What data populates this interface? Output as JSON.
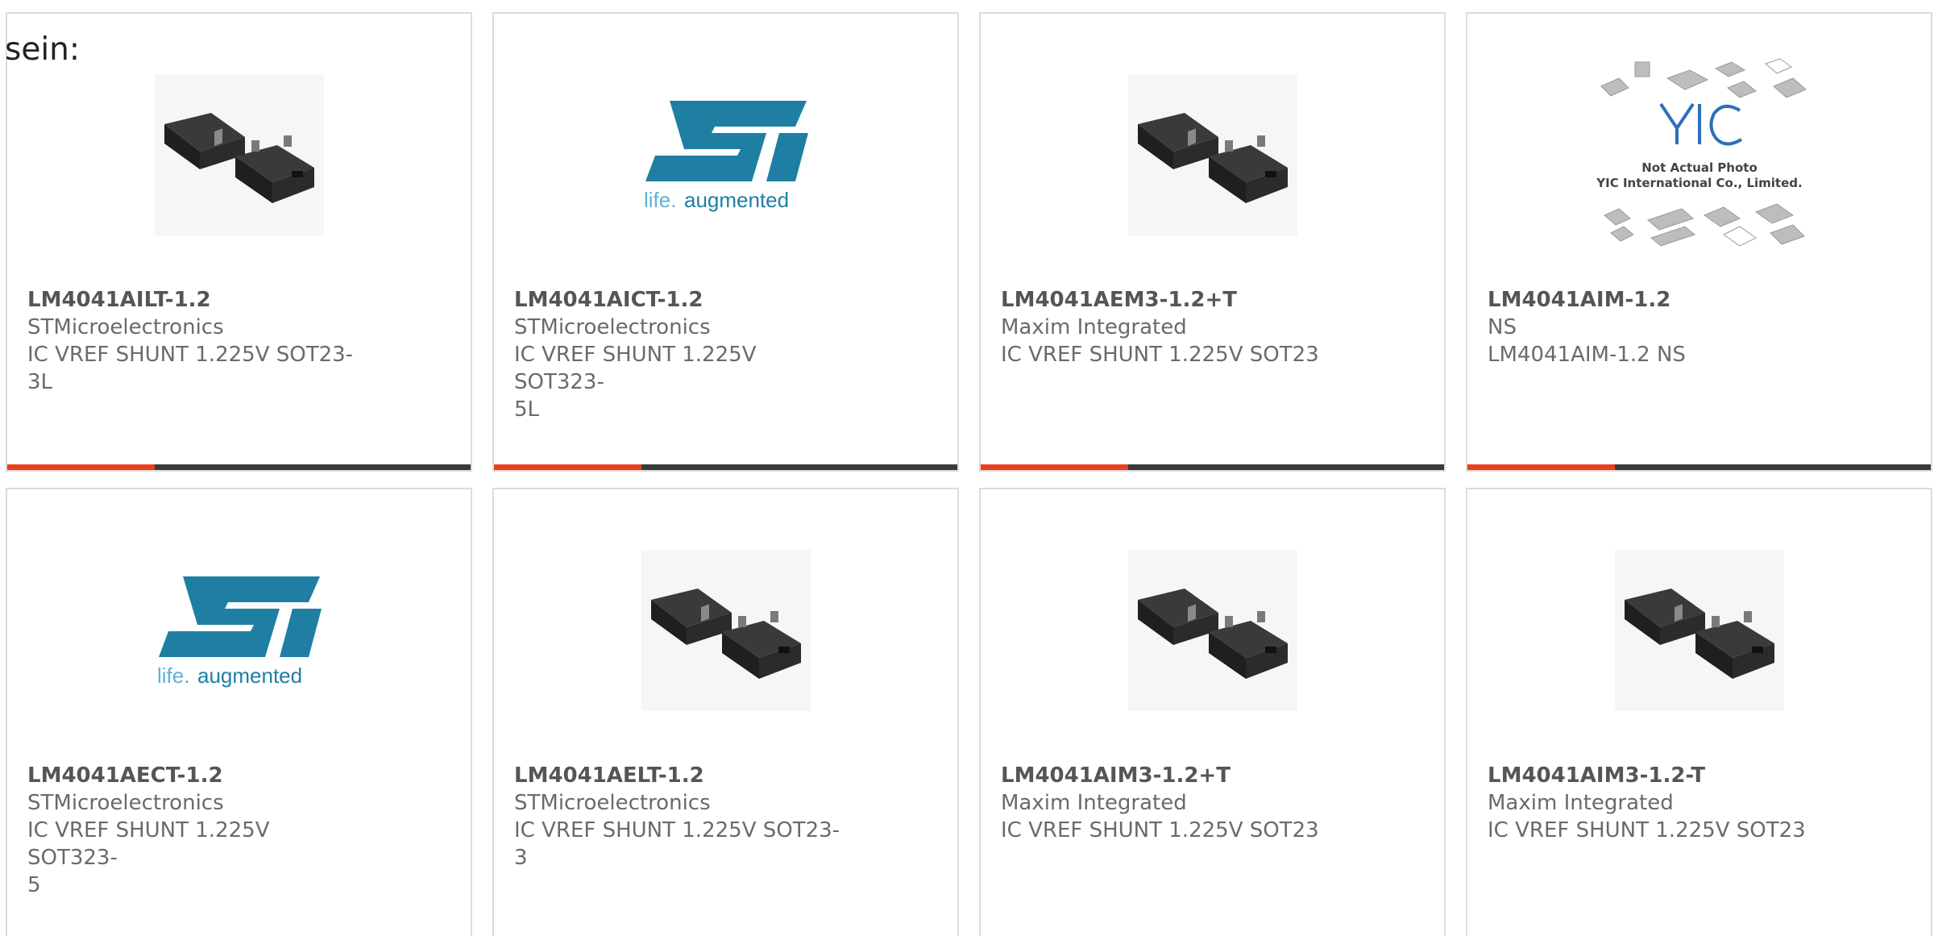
{
  "intro_text": "sein:",
  "colors": {
    "accent": "#e8401c",
    "bar_dark": "#3a3a3a",
    "card_border": "#dcdcdc",
    "st_blue": "#1f7fa3",
    "st_light": "#5bb3d6",
    "yic_blue": "#2d6fb8"
  },
  "products": [
    {
      "part": "LM4041AILT-1.2",
      "manufacturer": "STMicroelectronics",
      "description": "IC VREF SHUNT 1.225V SOT23-\n3L",
      "image": "sot23-chip",
      "desc_lines": [
        "IC VREF SHUNT 1.225V SOT23-",
        "3L"
      ]
    },
    {
      "part": "LM4041AICT-1.2",
      "manufacturer": "STMicroelectronics",
      "description": "IC VREF SHUNT 1.225V SOT323-\n5L",
      "image": "st-logo",
      "logo_tagline": "life.augmented",
      "desc_lines": [
        "IC VREF SHUNT 1.225V SOT323-",
        "5L"
      ]
    },
    {
      "part": "LM4041AEM3-1.2+T",
      "manufacturer": "Maxim Integrated",
      "description": "IC VREF SHUNT 1.225V SOT23",
      "image": "sot23-chip",
      "desc_lines": [
        "IC VREF SHUNT 1.225V SOT23"
      ]
    },
    {
      "part": "LM4041AIM-1.2",
      "manufacturer": "NS",
      "description": "LM4041AIM-1.2 NS",
      "image": "yic-placeholder",
      "placeholder_line1": "Not Actual Photo",
      "placeholder_line2": "YIC International Co., Limited.",
      "desc_lines": [
        "LM4041AIM-1.2 NS"
      ]
    },
    {
      "part": "LM4041AECT-1.2",
      "manufacturer": "STMicroelectronics",
      "description": "IC VREF SHUNT 1.225V SOT323-\n5",
      "image": "st-logo",
      "logo_tagline": "life.augmented",
      "desc_lines": [
        "IC VREF SHUNT 1.225V SOT323-",
        "5"
      ]
    },
    {
      "part": "LM4041AELT-1.2",
      "manufacturer": "STMicroelectronics",
      "description": "IC VREF SHUNT 1.225V SOT23-3",
      "image": "sot23-chip",
      "desc_lines": [
        "IC VREF SHUNT 1.225V SOT23-3"
      ]
    },
    {
      "part": "LM4041AIM3-1.2+T",
      "manufacturer": "Maxim Integrated",
      "description": "IC VREF SHUNT 1.225V SOT23",
      "image": "sot23-chip",
      "desc_lines": [
        "IC VREF SHUNT 1.225V SOT23"
      ]
    },
    {
      "part": "LM4041AIM3-1.2-T",
      "manufacturer": "Maxim Integrated",
      "description": "IC VREF SHUNT 1.225V SOT23",
      "image": "sot23-chip",
      "desc_lines": [
        "IC VREF SHUNT 1.225V SOT23"
      ]
    }
  ]
}
